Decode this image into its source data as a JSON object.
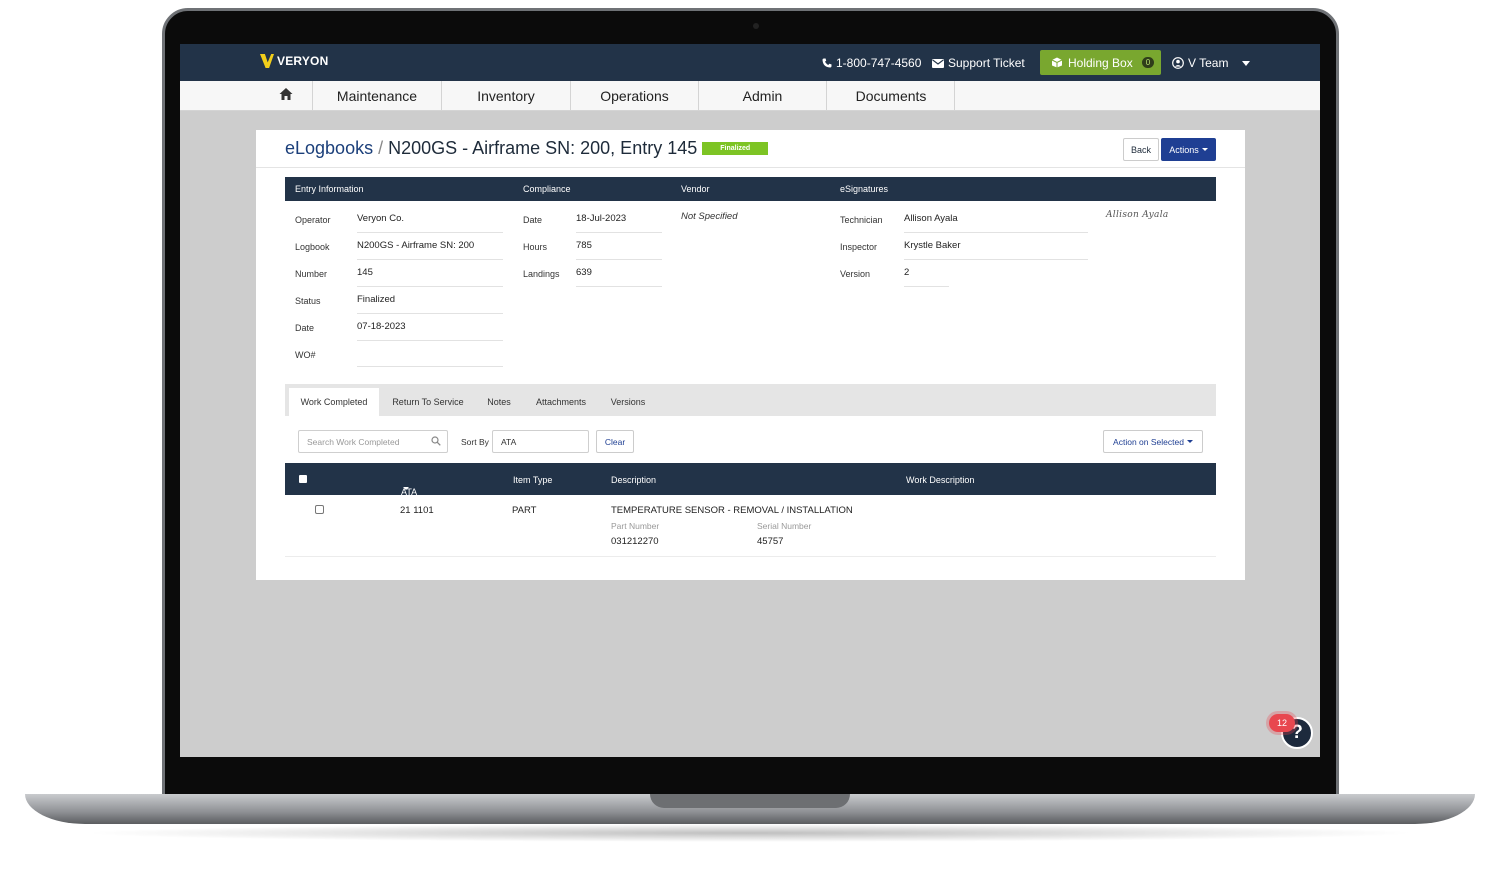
{
  "topbar": {
    "brand": "VERYON",
    "phone": "1-800-747-4560",
    "support": "Support Ticket",
    "holding_box": "Holding Box",
    "holding_count": "0",
    "user": "V Team"
  },
  "nav": {
    "items": [
      "Maintenance",
      "Inventory",
      "Operations",
      "Admin",
      "Documents"
    ]
  },
  "page": {
    "crumb_root": "eLogbooks",
    "crumb_sep": "/",
    "title": "N200GS - Airframe SN: 200, Entry 145",
    "status_badge": "Finalized",
    "back": "Back",
    "actions": "Actions"
  },
  "sections": {
    "entry": "Entry Information",
    "compliance": "Compliance",
    "vendor": "Vendor",
    "esignatures": "eSignatures"
  },
  "entry": {
    "operator_label": "Operator",
    "operator": "Veryon Co.",
    "logbook_label": "Logbook",
    "logbook": "N200GS - Airframe SN: 200",
    "number_label": "Number",
    "number": "145",
    "status_label": "Status",
    "status": "Finalized",
    "date_label": "Date",
    "date": "07-18-2023",
    "wo_label": "WO#",
    "wo": ""
  },
  "compliance": {
    "date_label": "Date",
    "date": "18-Jul-2023",
    "hours_label": "Hours",
    "hours": "785",
    "landings_label": "Landings",
    "landings": "639"
  },
  "vendor": {
    "value": "Not Specified"
  },
  "esig": {
    "technician_label": "Technician",
    "technician": "Allison Ayala",
    "inspector_label": "Inspector",
    "inspector": "Krystle Baker",
    "version_label": "Version",
    "version": "2",
    "signature": "Allison Ayala"
  },
  "tabs": [
    "Work Completed",
    "Return To Service",
    "Notes",
    "Attachments",
    "Versions"
  ],
  "toolbar": {
    "search_placeholder": "Search Work Completed",
    "sort_label": "Sort By",
    "sort_value": "ATA",
    "clear": "Clear",
    "action_selected": "Action on Selected"
  },
  "table": {
    "headers": [
      "ATA & Mfg Code",
      "Item Type",
      "Description",
      "Work Description"
    ],
    "rows": [
      {
        "ata": "21 1101",
        "type": "PART",
        "description": "TEMPERATURE SENSOR - REMOVAL / INSTALLATION",
        "part_label": "Part Number",
        "part": "031212270",
        "serial_label": "Serial Number",
        "serial": "45757"
      }
    ]
  },
  "help": {
    "icon_text": "?",
    "badge": "12"
  },
  "colors": {
    "header_bg": "#223348",
    "accent_green": "#79a72f",
    "badge_green": "#7dc424",
    "primary_blue": "#1f3f93",
    "help_badge": "#e8474f"
  }
}
